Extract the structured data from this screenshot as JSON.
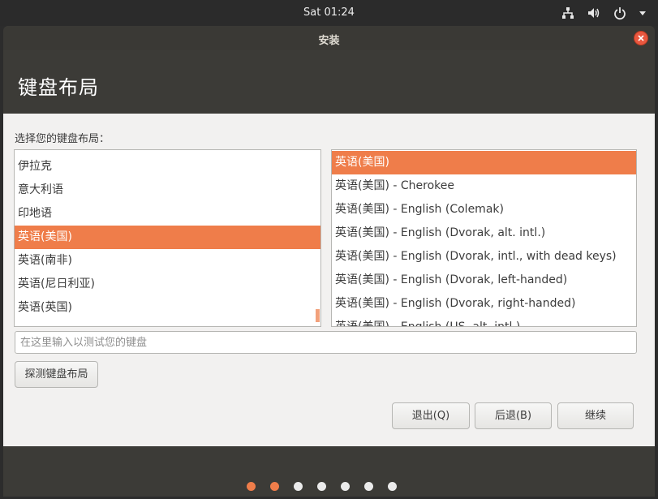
{
  "topbar": {
    "clock": "Sat 01:24",
    "icons": [
      "network-icon",
      "volume-icon",
      "power-icon",
      "menu-caret-icon"
    ]
  },
  "window": {
    "title": "安装",
    "page_title": "键盘布局",
    "prompt": "选择您的键盘布局："
  },
  "layouts": {
    "items": [
      "伊拉克",
      "意大利语",
      "印地语",
      "英语(美国)",
      "英语(南非)",
      "英语(尼日利亚)",
      "英语(英国)"
    ],
    "selected": "英语(美国)"
  },
  "variants": {
    "items": [
      "英语(美国)",
      "英语(美国) - Cherokee",
      "英语(美国) - English (Colemak)",
      "英语(美国) - English (Dvorak, alt. intl.)",
      "英语(美国) - English (Dvorak, intl., with dead keys)",
      "英语(美国) - English (Dvorak, left-handed)",
      "英语(美国) - English (Dvorak, right-handed)",
      "英语(美国) - English (US, alt. intl.)"
    ],
    "selected": "英语(美国)"
  },
  "test_input": {
    "placeholder": "在这里输入以测试您的键盘",
    "value": ""
  },
  "buttons": {
    "detect": "探测键盘布局",
    "quit": "退出(Q)",
    "back": "后退(B)",
    "continue": "继续"
  },
  "progress": {
    "total_steps": 7,
    "completed_steps": 2
  },
  "colors": {
    "accent": "#ef7d4a",
    "header_bg": "#3c3b37",
    "close_button": "#e9573f"
  }
}
